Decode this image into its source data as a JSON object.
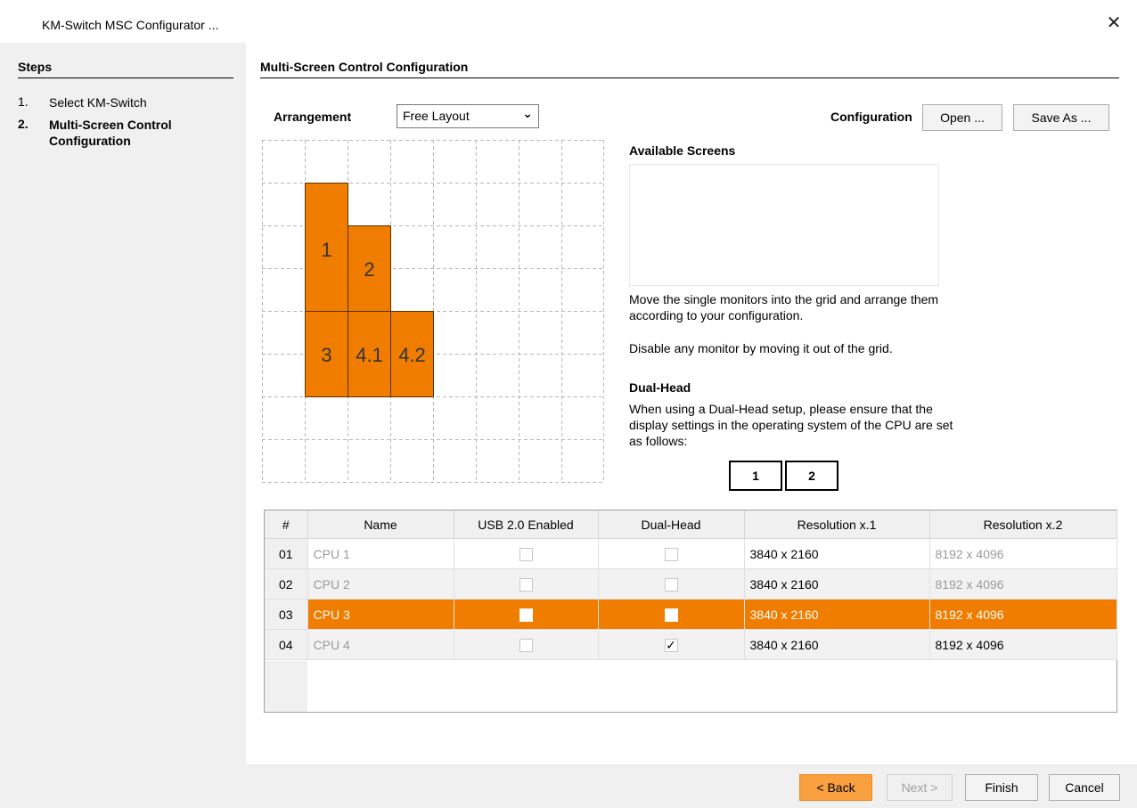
{
  "window": {
    "title": "KM-Switch MSC Configurator ...",
    "close_icon": "close-icon"
  },
  "steps": {
    "title": "Steps",
    "items": [
      {
        "num": "1.",
        "label": "Select KM-Switch"
      },
      {
        "num": "2.",
        "label": "Multi-Screen Control Configuration"
      }
    ]
  },
  "main": {
    "title": "Multi-Screen Control Configuration",
    "arrangement_label": "Arrangement",
    "arrangement_value": "Free Layout",
    "configuration_label": "Configuration",
    "open_label": "Open ...",
    "save_as_label": "Save As ...",
    "screens": [
      {
        "label": "1"
      },
      {
        "label": "2"
      },
      {
        "label": "3"
      },
      {
        "label": "4.1"
      },
      {
        "label": "4.2"
      }
    ],
    "available_title": "Available Screens",
    "info1": "Move the single monitors into the grid and arrange them according to your configuration.",
    "info2": "Disable any monitor by moving it out of the grid.",
    "dual_title": "Dual-Head",
    "dual_text": "When using a Dual-Head setup, please ensure that the display settings in the operating system of the CPU are set as follows:",
    "dual_boxes": [
      "1",
      "2"
    ]
  },
  "table": {
    "headers": [
      "#",
      "Name",
      "USB 2.0 Enabled",
      "Dual-Head",
      "Resolution x.1",
      "Resolution x.2"
    ],
    "rows": [
      {
        "num": "01",
        "name": "CPU 1",
        "usb": false,
        "dual": false,
        "res1": "3840 x 2160",
        "res2": "8192 x 4096"
      },
      {
        "num": "02",
        "name": "CPU 2",
        "usb": false,
        "dual": false,
        "res1": "3840 x 2160",
        "res2": "8192 x 4096"
      },
      {
        "num": "03",
        "name": "CPU 3",
        "usb": false,
        "dual": false,
        "res1": "3840 x 2160",
        "res2": "8192 x 4096",
        "selected": true
      },
      {
        "num": "04",
        "name": "CPU 4",
        "usb": false,
        "dual": true,
        "res1": "3840 x 2160",
        "res2": "8192 x 4096"
      }
    ],
    "check_mark": "✓"
  },
  "footer": {
    "back_label": "< Back",
    "next_label": "Next >",
    "finish_label": "Finish",
    "cancel_label": "Cancel"
  },
  "colors": {
    "accent": "#f07d00",
    "back_button": "#f9a040"
  }
}
